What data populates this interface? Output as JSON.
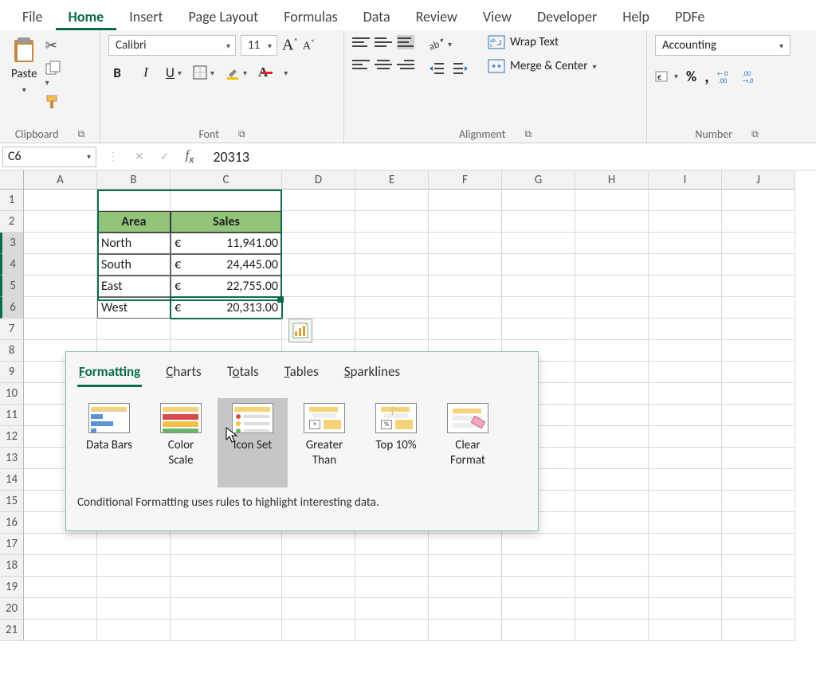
{
  "tabs": {
    "file": "File",
    "home": "Home",
    "insert": "Insert",
    "pagelayout": "Page Layout",
    "formulas": "Formulas",
    "data": "Data",
    "review": "Review",
    "view": "View",
    "developer": "Developer",
    "help": "Help",
    "pdf": "PDFe"
  },
  "ribbon": {
    "clipboard": {
      "paste": "Paste",
      "label": "Clipboard"
    },
    "font": {
      "name": "Calibri",
      "size": "11",
      "label": "Font"
    },
    "alignment": {
      "wrap": "Wrap Text",
      "merge": "Merge & Center",
      "label": "Alignment"
    },
    "number": {
      "format": "Accounting",
      "label": "Number"
    }
  },
  "fbar": {
    "name": "C6",
    "value": "20313"
  },
  "cols": [
    "A",
    "B",
    "C",
    "D",
    "E",
    "F",
    "G",
    "H",
    "I",
    "J"
  ],
  "rowcount": 21,
  "table": {
    "h1": "Area",
    "h2": "Sales",
    "rows": [
      {
        "area": "North",
        "cur": "€",
        "val": "11,941.00"
      },
      {
        "area": "South",
        "cur": "€",
        "val": "24,445.00"
      },
      {
        "area": "East",
        "cur": "€",
        "val": "22,755.00"
      },
      {
        "area": "West",
        "cur": "€",
        "val": "20,313.00"
      }
    ]
  },
  "qa": {
    "tabs": {
      "formatting": "ormatting",
      "charts": "harts",
      "totals": "otals",
      "tables": "ables",
      "sparklines": "parklines"
    },
    "prefix": {
      "formatting": "F",
      "charts": "C",
      "totals": "T",
      "tables": "T",
      "sparklines": "S"
    },
    "items": {
      "databars": "Data Bars",
      "colorscale": "Color\nScale",
      "iconset": "Icon Set",
      "greater": "Greater\nThan",
      "top10": "Top 10%",
      "clear": "Clear\nFormat"
    },
    "desc": "Conditional Formatting uses rules to highlight interesting data."
  }
}
